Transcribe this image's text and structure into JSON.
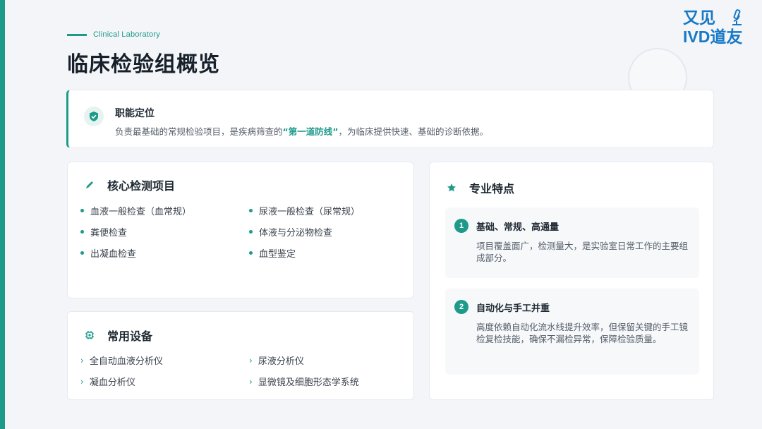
{
  "header": {
    "eyebrow": "Clinical Laboratory",
    "title": "临床检验组概览"
  },
  "logo": {
    "line1": "又见",
    "line2": "IVD道友",
    "icon": "microscope-icon"
  },
  "positioning": {
    "icon": "shield-check-icon",
    "title": "职能定位",
    "desc_before": "负责最基础的常规检验项目，是疾病筛查的",
    "desc_highlight": "“第一道防线”",
    "desc_after": "，为临床提供快速、基础的诊断依据。"
  },
  "core_tests": {
    "icon": "pen-icon",
    "title": "核心检测项目",
    "items": [
      "血液一般检查（血常规）",
      "尿液一般检查（尿常规）",
      "粪便检查",
      "体液与分泌物检查",
      "出凝血检查",
      "血型鉴定"
    ]
  },
  "equipment": {
    "icon": "chip-icon",
    "title": "常用设备",
    "items": [
      "全自动血液分析仪",
      "尿液分析仪",
      "凝血分析仪",
      "显微镜及细胞形态学系统"
    ]
  },
  "features": {
    "icon": "star-icon",
    "title": "专业特点",
    "items": [
      {
        "num": "1",
        "title": "基础、常规、高通量",
        "desc": "项目覆盖面广，检测量大，是实验室日常工作的主要组成部分。"
      },
      {
        "num": "2",
        "title": "自动化与手工并重",
        "desc": "高度依赖自动化流水线提升效率，但保留关键的手工镜检复检技能，确保不漏检异常，保障检验质量。"
      }
    ]
  },
  "colors": {
    "accent": "#1d9a8a",
    "logo_blue": "#1779c6"
  }
}
